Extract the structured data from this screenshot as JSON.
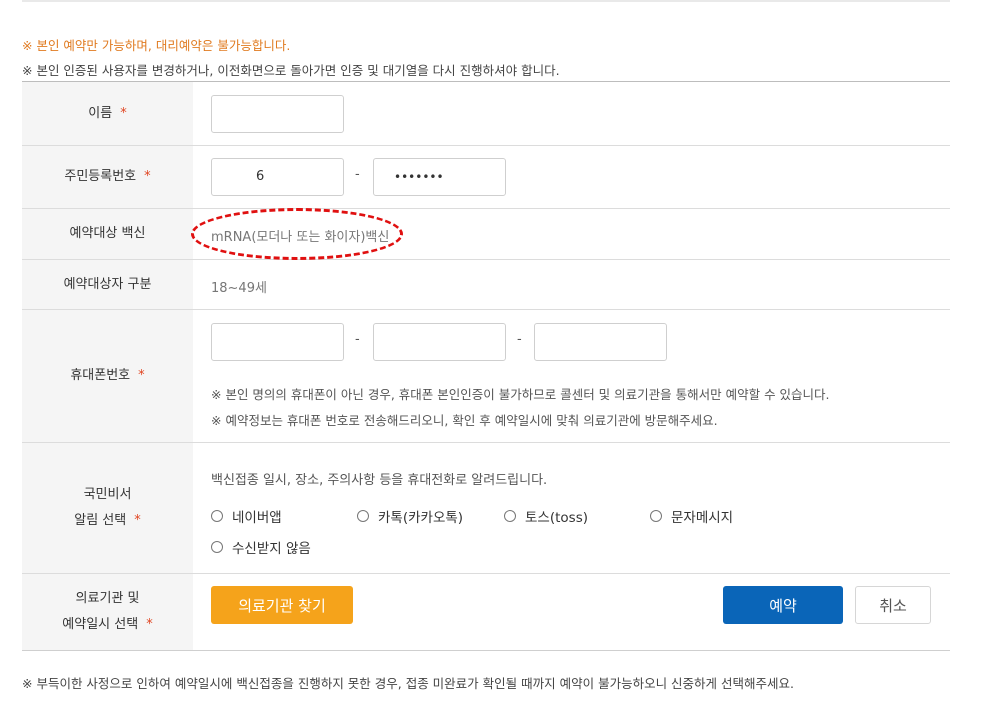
{
  "notices": {
    "line1": "※ 본인 예약만 가능하며, 대리예약은 불가능합니다.",
    "line2": "※ 본인 인증된 사용자를 변경하거나, 이전화면으로 돌아가면 인증 및 대기열을 다시 진행하셔야 합니다."
  },
  "form": {
    "required_mark": "*",
    "name": {
      "label": "이름",
      "value": ""
    },
    "rrn": {
      "label": "주민등록번호",
      "front_value": "6",
      "separator": "-",
      "back_value": "•••••••"
    },
    "vaccine": {
      "label": "예약대상 백신",
      "value": "mRNA(모더나 또는 화이자)백신"
    },
    "target_group": {
      "label": "예약대상자 구분",
      "value": "18~49세"
    },
    "phone": {
      "label": "휴대폰번호",
      "part1": "",
      "part2": "",
      "part3": "",
      "separator": "-",
      "note1": "※ 본인 명의의 휴대폰이 아닌 경우, 휴대폰 본인인증이 불가하므로 콜센터 및 의료기관을 통해서만 예약할 수 있습니다.",
      "note2": "※ 예약정보는 휴대폰 번호로 전송해드리오니, 확인 후 예약일시에 맞춰 의료기관에 방문해주세요."
    },
    "notification": {
      "label_line1": "국민비서",
      "label_line2": "알림 선택",
      "desc": "백신접종 일시, 장소, 주의사항 등을 휴대전화로 알려드립니다.",
      "options": [
        "네이버앱",
        "카톡(카카오톡)",
        "토스(toss)",
        "문자메시지",
        "수신받지 않음"
      ]
    },
    "facility": {
      "label_line1": "의료기관 및",
      "label_line2": "예약일시 선택",
      "find_button": "의료기관 찾기",
      "reserve_button": "예약",
      "cancel_button": "취소"
    }
  },
  "footer": "※ 부득이한 사정으로 인하여 예약일시에 백신접종을 진행하지 못한 경우, 접종 미완료가 확인될 때까지 예약이 불가능하오니 신중하게 선택해주세요.",
  "colors": {
    "notice_orange": "#e07b21",
    "required_red": "#e0431f",
    "find_button": "#f5a31b",
    "reserve_button": "#0a65b8",
    "highlight_ellipse": "#e01010"
  }
}
